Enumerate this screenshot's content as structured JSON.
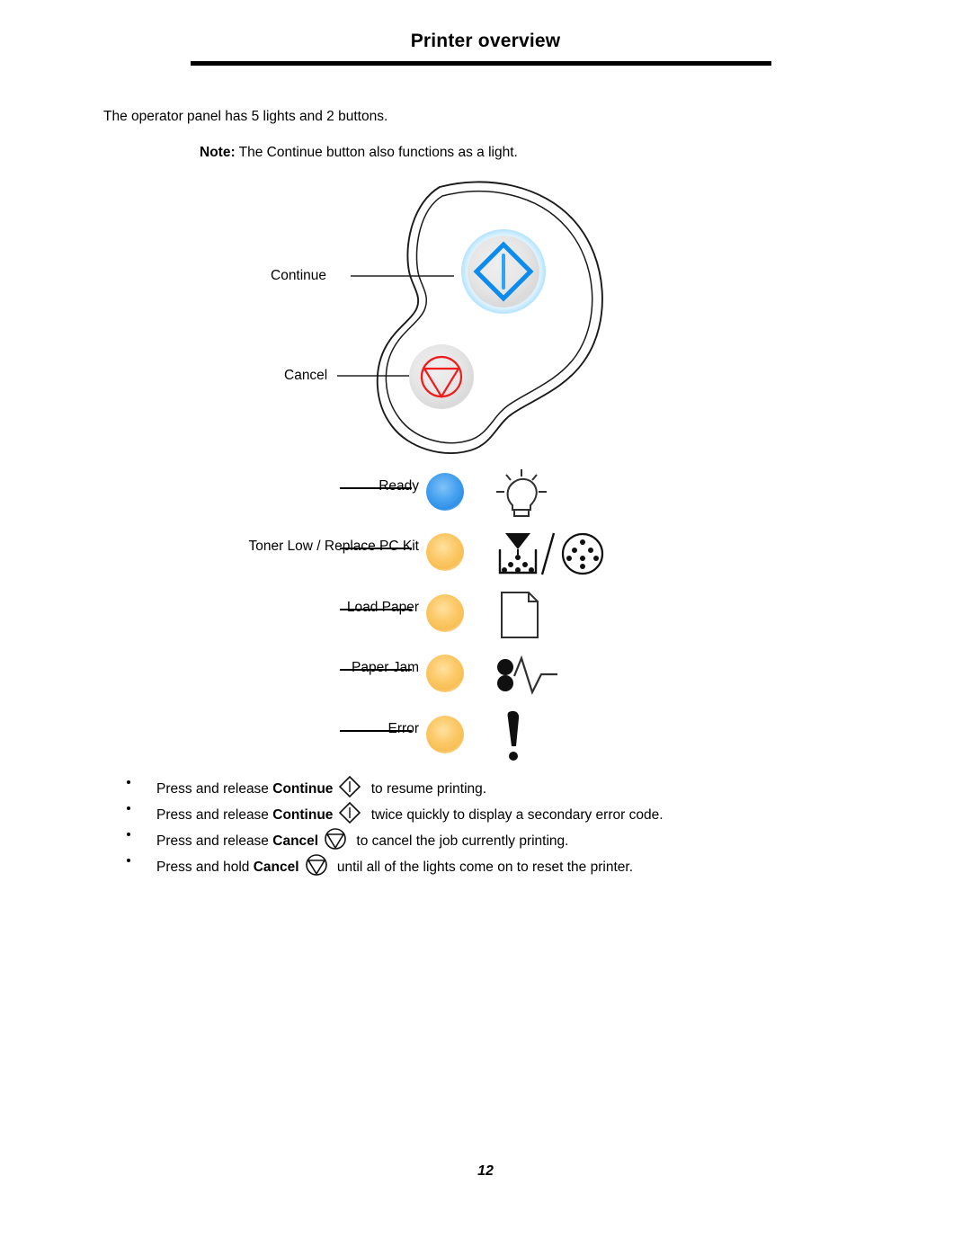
{
  "document": {
    "title": "Printer overview",
    "page_number": "12"
  },
  "intro": {
    "line": "The operator panel has 5 lights and 2 buttons.",
    "note_label": "Note:",
    "note_text": "The Continue button also functions as a light."
  },
  "panel": {
    "buttons": [
      {
        "name": "continue",
        "label": "Continue",
        "icon": "diamond-bar-icon",
        "icon_color": "#0a8bf0",
        "glow_color": "#78cdff"
      },
      {
        "name": "cancel",
        "label": "Cancel",
        "icon": "circle-triangle-down-icon",
        "icon_color": "#f01c1c"
      }
    ]
  },
  "lights": [
    {
      "label": "Ready",
      "color": "#3b9aee",
      "tone": "blue",
      "icon": "light-bulb-icon"
    },
    {
      "label": "Toner Low / Replace PC Kit",
      "color": "#f8bf55",
      "tone": "amber",
      "icon": "toner-hopper-and-pc-kit-icon"
    },
    {
      "label": "Load Paper",
      "color": "#f8bf55",
      "tone": "amber",
      "icon": "paper-sheet-icon"
    },
    {
      "label": "Paper Jam",
      "color": "#f8bf55",
      "tone": "amber",
      "icon": "paper-jam-rollers-icon"
    },
    {
      "label": "Error",
      "color": "#f8bf55",
      "tone": "amber",
      "icon": "exclamation-mark-icon"
    }
  ],
  "instructions": [
    {
      "prefix": "Press and release ",
      "button": "Continue",
      "icon": "diamond-bar-icon",
      "suffix": " to resume printing."
    },
    {
      "prefix": "Press and release ",
      "button": "Continue",
      "icon": "diamond-bar-icon",
      "suffix": " twice quickly to display a secondary error code."
    },
    {
      "prefix": "Press and release ",
      "button": "Cancel",
      "icon": "circle-triangle-down-icon",
      "suffix": " to cancel the job currently printing."
    },
    {
      "prefix": "Press and hold ",
      "button": "Cancel",
      "icon": "circle-triangle-down-icon",
      "suffix": " until all of the lights come on to reset the printer."
    }
  ]
}
